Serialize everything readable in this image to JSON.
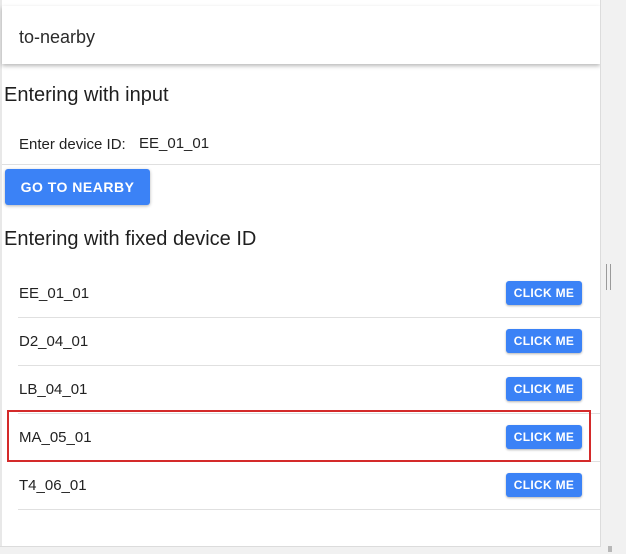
{
  "toolbar": {
    "title": "to-nearby"
  },
  "input_section": {
    "heading": "Entering with input",
    "label": "Enter device ID:",
    "value": "EE_01_01",
    "button_label": "GO TO NEARBY"
  },
  "fixed_section": {
    "heading": "Entering with fixed device ID",
    "items": [
      {
        "device_id": "EE_01_01",
        "button_label": "CLICK ME"
      },
      {
        "device_id": "D2_04_01",
        "button_label": "CLICK ME"
      },
      {
        "device_id": "LB_04_01",
        "button_label": "CLICK ME"
      },
      {
        "device_id": "MA_05_01",
        "button_label": "CLICK ME"
      },
      {
        "device_id": "T4_06_01",
        "button_label": "CLICK ME"
      }
    ]
  },
  "colors": {
    "button_blue": "#3b82f6",
    "highlight_red": "#d42a2a"
  }
}
